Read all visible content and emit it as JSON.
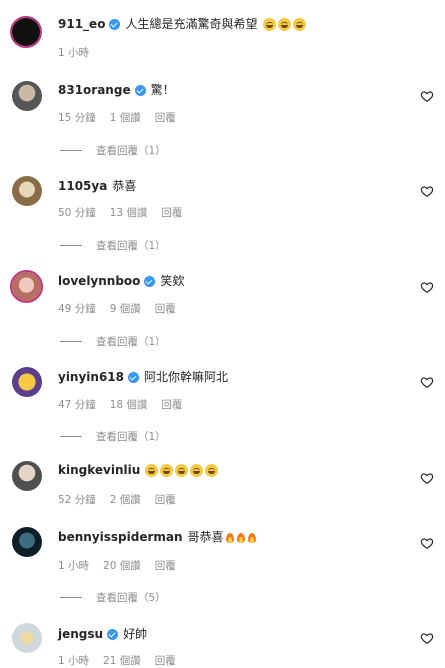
{
  "caption": {
    "username": "911_eo",
    "text": "人生總是充滿驚奇與希望",
    "emoji_count": 3,
    "time": "1 小時"
  },
  "comments": [
    {
      "username": "831orange",
      "verified": true,
      "text": "驚！",
      "time": "15 分鐘",
      "likes": "1 個讚",
      "reply_label": "回覆",
      "view_replies": "查看回覆（1）",
      "avatar_color": "#6b6b6b"
    },
    {
      "username": "1105ya",
      "verified": false,
      "text": "恭喜",
      "time": "50 分鐘",
      "likes": "13 個讚",
      "reply_label": "回覆",
      "view_replies": "查看回覆（1）",
      "avatar_color": "#a48a6a"
    },
    {
      "username": "lovelynnboo",
      "verified": true,
      "text": "笑欸",
      "time": "49 分鐘",
      "likes": "9 個讚",
      "reply_label": "回覆",
      "view_replies": "查看回覆（1）",
      "avatar_color": "#d9a49a"
    },
    {
      "username": "yinyin618",
      "verified": true,
      "text": "阿北你幹嘛阿北",
      "time": "47 分鐘",
      "likes": "18 個讚",
      "reply_label": "回覆",
      "view_replies": "查看回覆（1）",
      "avatar_color": "#5b3f8c"
    },
    {
      "username": "kingkevinliu",
      "verified": false,
      "text": "",
      "emoji_count": 5,
      "time": "52 分鐘",
      "likes": "2 個讚",
      "reply_label": "回覆",
      "view_replies": "",
      "avatar_color": "#8f8f8f"
    },
    {
      "username": "bennyisspiderman",
      "verified": false,
      "text": "哥恭喜",
      "fire_count": 3,
      "time": "1 小時",
      "likes": "20 個讚",
      "reply_label": "回覆",
      "view_replies": "查看回覆（5）",
      "avatar_color": "#1f3a4a"
    },
    {
      "username": "jengsu",
      "verified": true,
      "text": "好帥",
      "time": "1 小時",
      "likes": "21 個讚",
      "reply_label": "回覆",
      "view_replies": "",
      "avatar_color": "#cfd8dc"
    }
  ],
  "colors": {
    "verified": "#3897f0",
    "meta_text": "#8e8e8e",
    "ring": "#c13584"
  },
  "icons": {
    "like": "heart-outline-icon",
    "verified": "verified-badge-icon"
  }
}
